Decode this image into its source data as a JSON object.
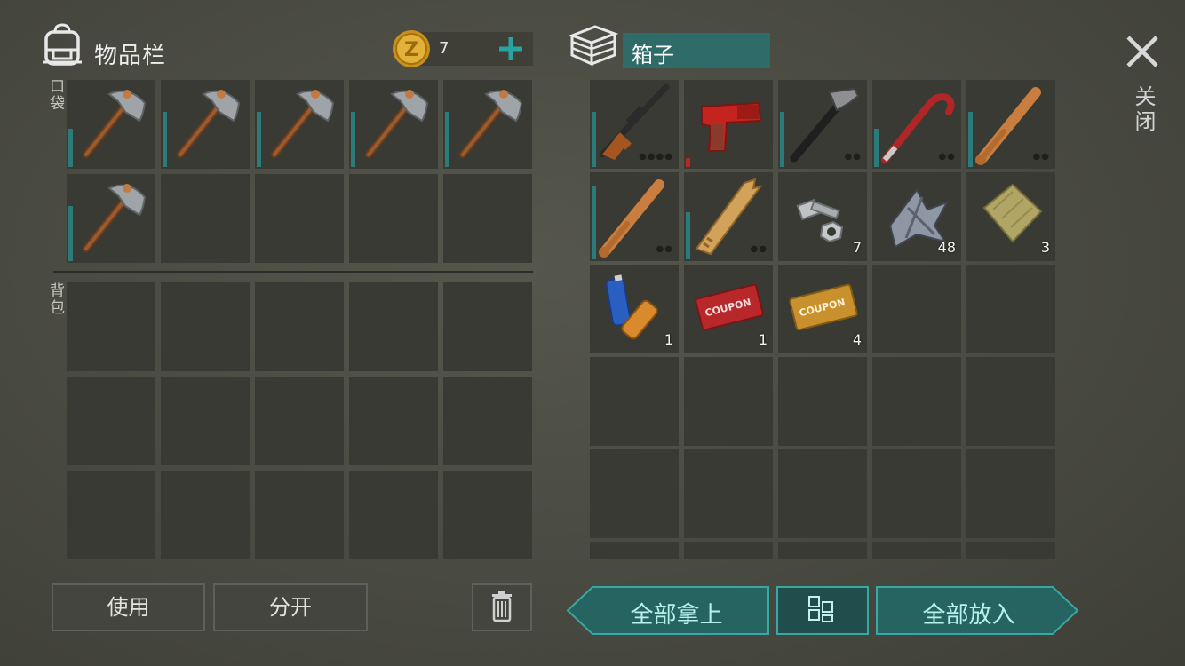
{
  "inventory": {
    "title": "物品栏",
    "coins": "7",
    "pocket_label": "口袋",
    "backpack_label": "背包"
  },
  "container": {
    "title": "箱子"
  },
  "close": {
    "label": "关闭"
  },
  "buttons": {
    "use": "使用",
    "split": "分开",
    "take_all": "全部拿上",
    "put_all": "全部放入"
  },
  "pocket_items": [
    {
      "name": "pickaxe",
      "durability": 0.45
    },
    {
      "name": "pickaxe",
      "durability": 0.65
    },
    {
      "name": "pickaxe",
      "durability": 0.65
    },
    {
      "name": "pickaxe",
      "durability": 0.65
    },
    {
      "name": "pickaxe",
      "durability": 0.65
    },
    {
      "name": "pickaxe",
      "durability": 0.65
    }
  ],
  "container_items": [
    {
      "name": "sniper-rifle",
      "durability": 0.65,
      "dots": "●●●●"
    },
    {
      "name": "flare-gun",
      "durability": 0.1,
      "durability_color": "red"
    },
    {
      "name": "hammer",
      "durability": 0.65,
      "dots": "●●"
    },
    {
      "name": "crowbar",
      "durability": 0.45,
      "dots": "●●"
    },
    {
      "name": "baseball-bat",
      "durability": 0.65,
      "dots": "●●"
    },
    {
      "name": "baseball-bat",
      "durability": 0.85,
      "dots": "●●"
    },
    {
      "name": "broken-plank",
      "durability": 0.55,
      "dots": "●●"
    },
    {
      "name": "nuts-and-bolts",
      "qty": "7"
    },
    {
      "name": "scrap-metal",
      "qty": "48"
    },
    {
      "name": "cloth",
      "qty": "3"
    },
    {
      "name": "batteries",
      "qty": "1"
    },
    {
      "name": "combat-gear-coupon",
      "qty": "1"
    },
    {
      "name": "survival-kit-coupon",
      "qty": "4"
    }
  ],
  "colors": {
    "accent_teal": "#2f6b69",
    "durability_teal": "#2b7b7a",
    "durability_red": "#b32a22",
    "slot_bg": "#393a33"
  }
}
